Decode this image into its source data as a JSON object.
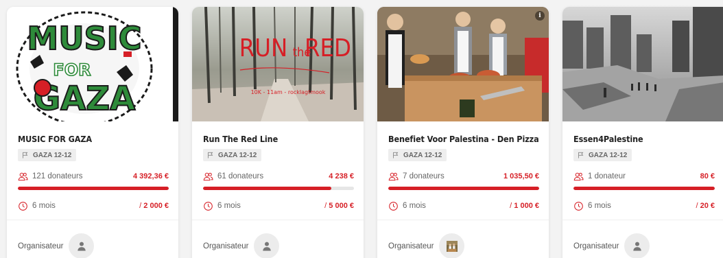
{
  "colors": {
    "accent": "#d61f26",
    "tag_bg": "#eeeeee",
    "card_bg": "#ffffff"
  },
  "labels": {
    "organizer": "Organisateur"
  },
  "cards": [
    {
      "title": "MUSIC FOR GAZA",
      "tag": "GAZA 12-12",
      "donors": "121 donateurs",
      "amount": "4 392,36 €",
      "duration": "6 mois",
      "goal_prefix": "/ ",
      "goal": "2 000 €",
      "progress": 1.0,
      "image_art": {
        "line1": "MUSIC",
        "line2": "FOR",
        "line3": "GAZA"
      },
      "organizer_avatar": "person-icon"
    },
    {
      "title": "Run The Red Line",
      "tag": "GAZA 12-12",
      "donors": "61 donateurs",
      "amount": "4 238 €",
      "duration": "6 mois",
      "goal_prefix": "/ ",
      "goal": "5 000 €",
      "progress": 0.85,
      "image_art": {
        "headline": "RUN the RED",
        "caption": "10K - 11am - rocklagtmook"
      },
      "organizer_avatar": "person-icon"
    },
    {
      "title": "Benefiet Voor Palestina - Den Pizzafiets",
      "tag": "GAZA 12-12",
      "donors": "7 donateurs",
      "amount": "1 035,50 €",
      "duration": "6 mois",
      "goal_prefix": "/ ",
      "goal": "1 000 €",
      "progress": 1.0,
      "image_art": {
        "info_badge": "i"
      },
      "organizer_avatar": "photo"
    },
    {
      "title": "Essen4Palestine",
      "tag": "GAZA 12-12",
      "donors": "1 donateur",
      "amount": "80 €",
      "duration": "6 mois",
      "goal_prefix": "/ ",
      "goal": "20 €",
      "progress": 1.0,
      "image_art": {},
      "organizer_avatar": "person-icon"
    }
  ]
}
